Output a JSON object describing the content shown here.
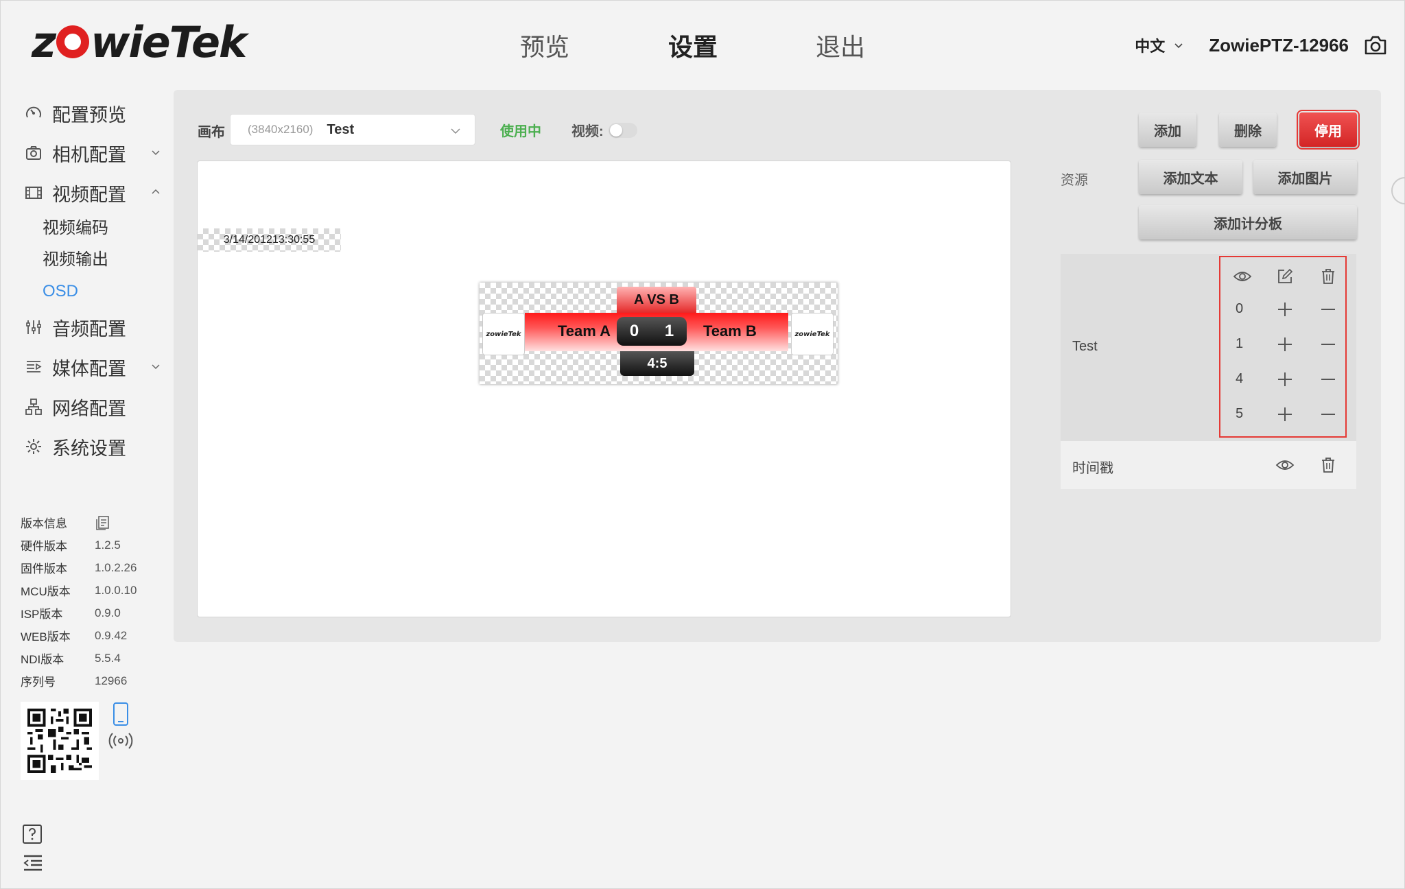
{
  "brand": {
    "logo_pre": "z",
    "logo_post": "wieTek"
  },
  "nav": {
    "items": [
      "预览",
      "设置",
      "退出"
    ],
    "active_index": 1
  },
  "header": {
    "language": "中文",
    "device_name": "ZowiePTZ-12966"
  },
  "sidebar": {
    "items": [
      {
        "label": "配置预览",
        "icon": "dashboard-icon"
      },
      {
        "label": "相机配置",
        "icon": "camera-icon",
        "expandable": true
      },
      {
        "label": "视频配置",
        "icon": "film-icon",
        "expanded": true
      },
      {
        "label": "音频配置",
        "icon": "audio-sliders-icon"
      },
      {
        "label": "媒体配置",
        "icon": "media-icon",
        "expandable": true
      },
      {
        "label": "网络配置",
        "icon": "network-icon"
      },
      {
        "label": "系统设置",
        "icon": "gear-icon"
      }
    ],
    "video_sub": [
      "视频编码",
      "视频输出",
      "OSD"
    ],
    "active_sub": "OSD"
  },
  "version": {
    "title": "版本信息",
    "rows": [
      {
        "k": "硬件版本",
        "v": "1.2.5"
      },
      {
        "k": "固件版本",
        "v": "1.0.2.26"
      },
      {
        "k": "MCU版本",
        "v": "1.0.0.10"
      },
      {
        "k": "ISP版本",
        "v": "0.9.0"
      },
      {
        "k": "WEB版本",
        "v": "0.9.42"
      },
      {
        "k": "NDI版本",
        "v": "5.5.4"
      },
      {
        "k": "序列号",
        "v": "12966"
      }
    ]
  },
  "toolbar": {
    "canvas_label": "画布",
    "canvas_resolution": "(3840x2160)",
    "canvas_name": "Test",
    "status": "使用中",
    "status_color": "#4caf50",
    "video_label": "视频:",
    "video_enabled": false,
    "add": "添加",
    "delete": "删除",
    "disable": "停用"
  },
  "resources": {
    "label": "资源",
    "add_text": "添加文本",
    "add_image": "添加图片",
    "add_scoreboard": "添加计分板"
  },
  "preview": {
    "timestamp": "3/14/201213:30:55",
    "scoreboard": {
      "title": "A VS B",
      "team_a": "Team A",
      "team_b": "Team B",
      "score_a": "0",
      "score_b": "1",
      "time": "4:5",
      "logo_text": "zowieTek"
    }
  },
  "layers": {
    "scoreboard_name": "Test",
    "values": [
      "0",
      "1",
      "4",
      "5"
    ],
    "timestamp_name": "时间戳"
  },
  "colors": {
    "accent": "#3a8ee6",
    "danger": "#e53935",
    "brand_red": "#e02020"
  }
}
